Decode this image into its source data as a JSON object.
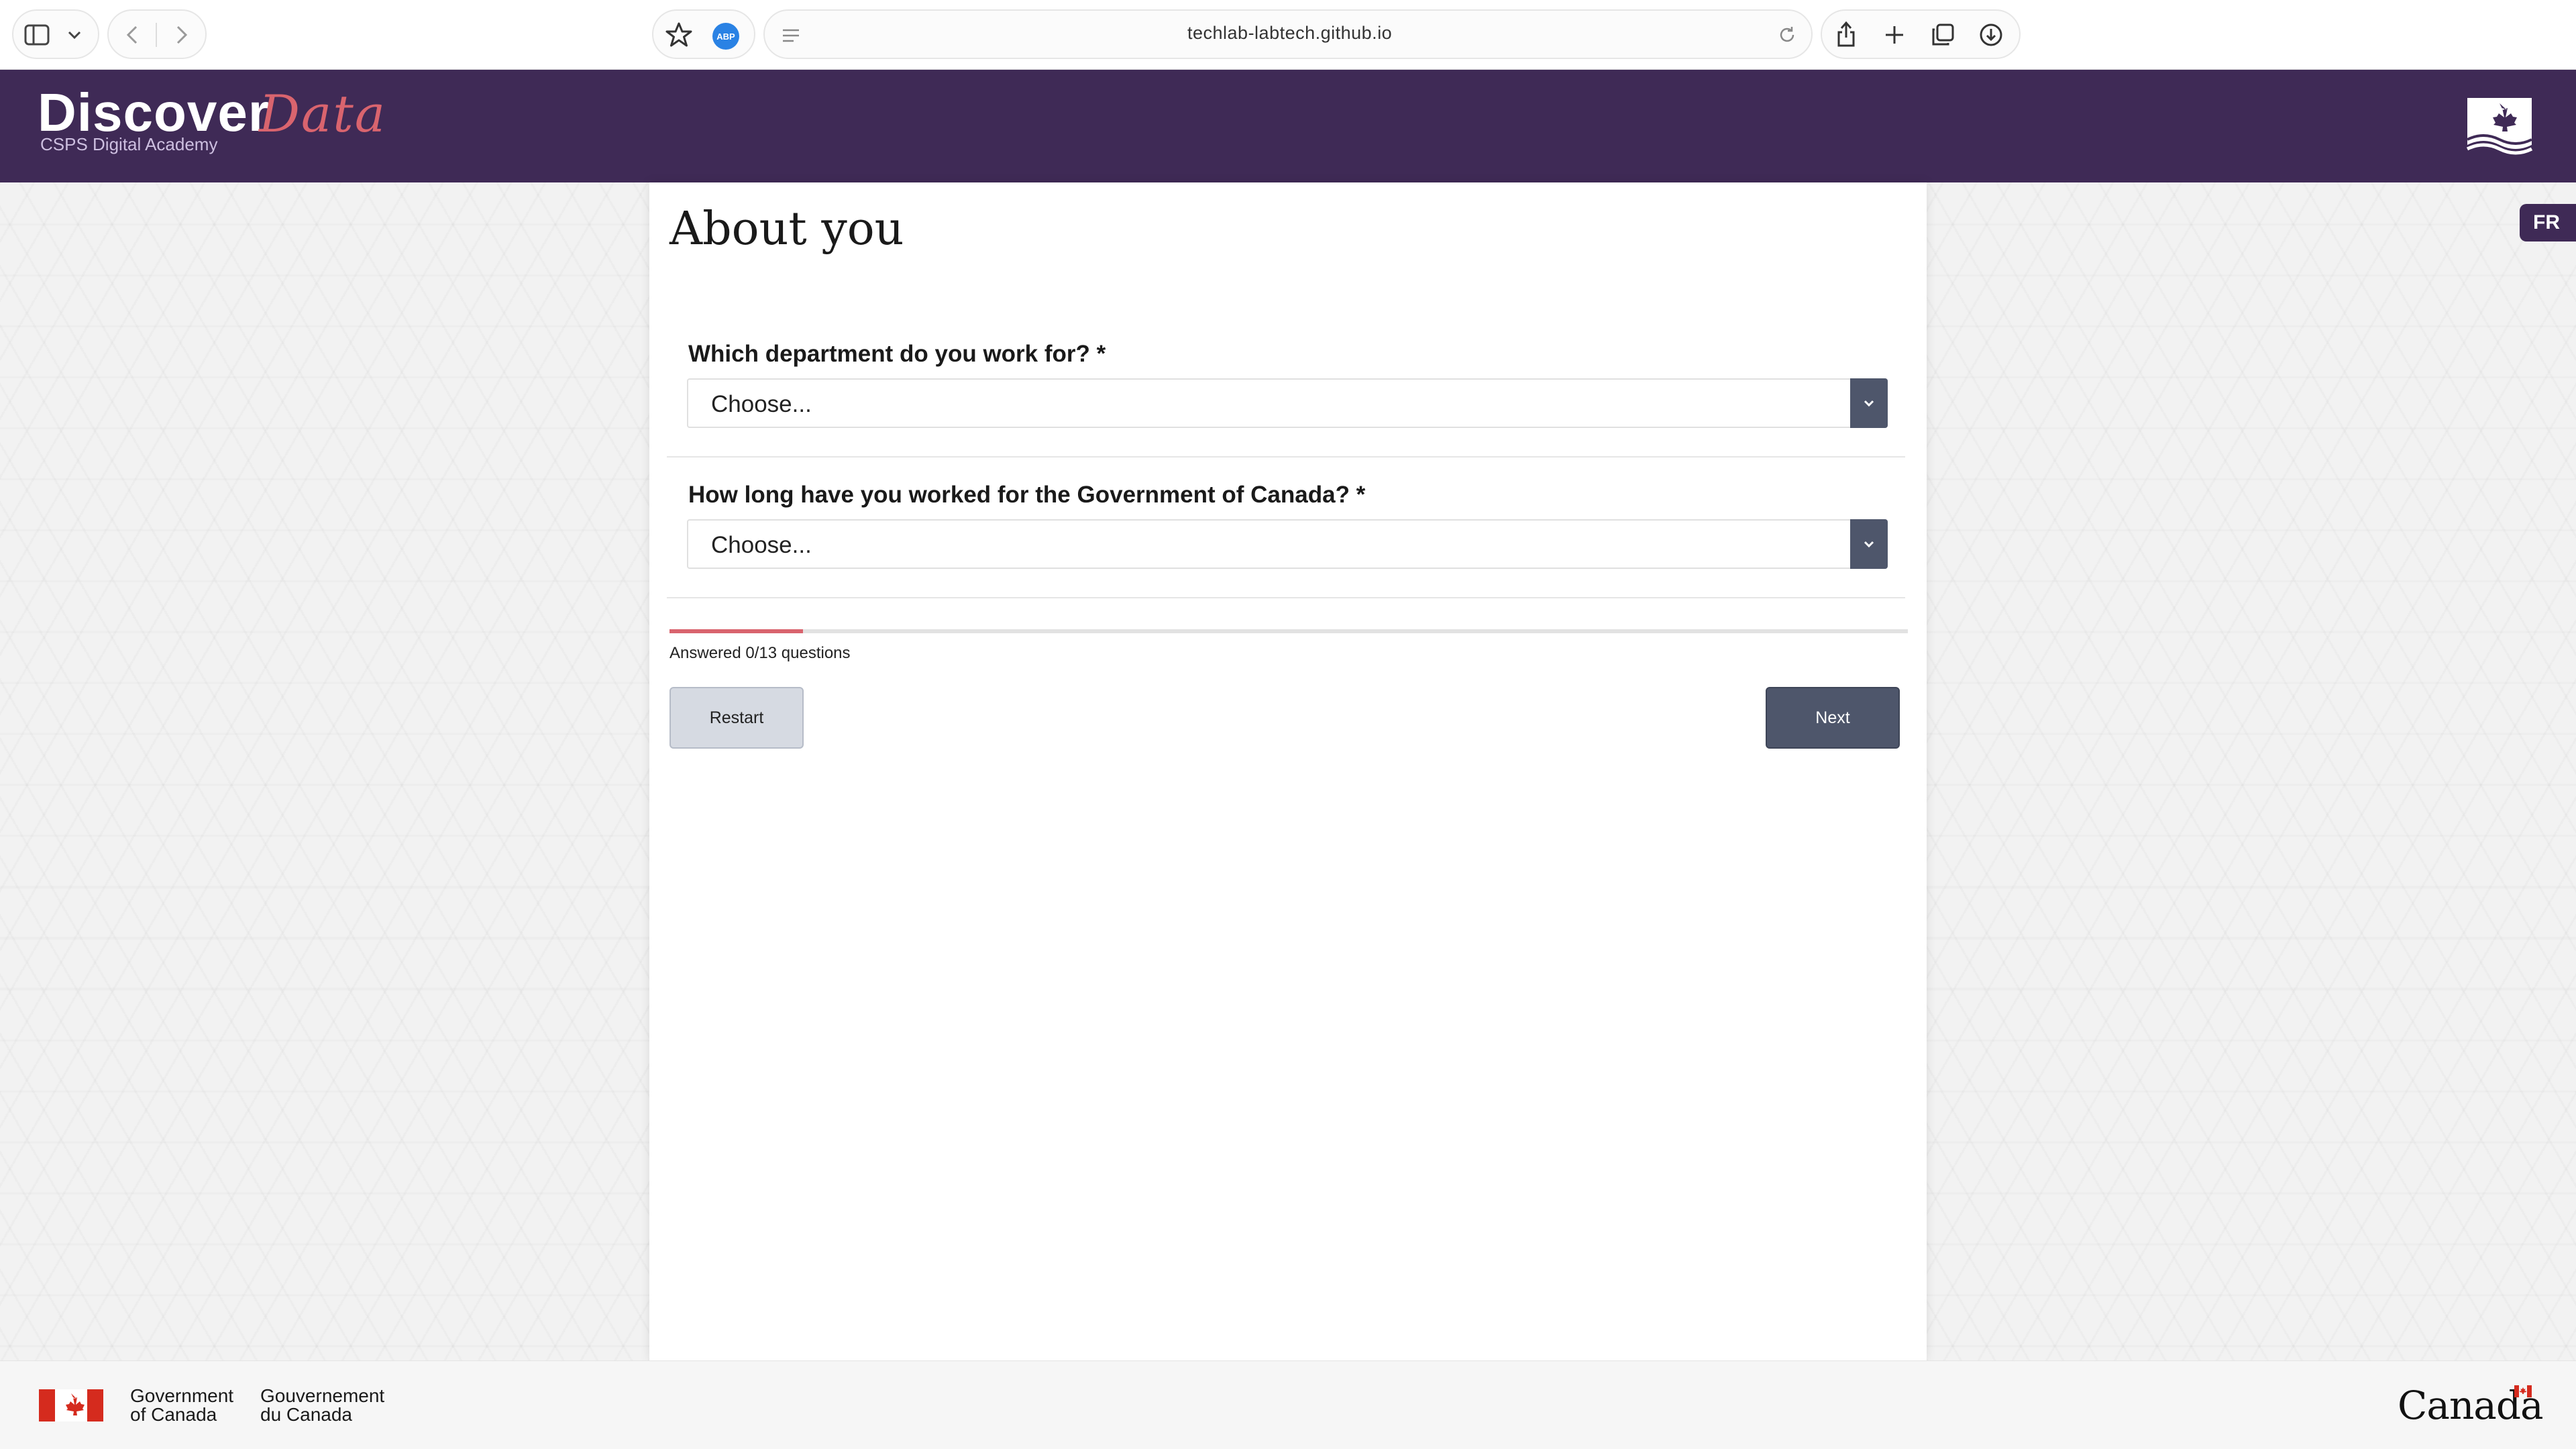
{
  "browser": {
    "url": "techlab-labtech.github.io",
    "extension_label": "ABP",
    "icons": [
      "sidebar-icon",
      "chevron-down-icon",
      "back-icon",
      "forward-icon",
      "star-icon",
      "reader-icon",
      "reload-icon",
      "share-icon",
      "plus-icon",
      "tabs-icon",
      "download-icon"
    ]
  },
  "header": {
    "logo_main": "Discover",
    "logo_accent": "Data",
    "logo_subtitle": "CSPS Digital Academy",
    "emblem_icon": "maple-leaf-emblem-icon"
  },
  "language_toggle": {
    "label": "FR"
  },
  "main": {
    "title": "About you",
    "questions": [
      {
        "label": "Which department do you work for? *",
        "selected": "Choose..."
      },
      {
        "label": "How long have you worked for the Government of Canada? *",
        "selected": "Choose..."
      }
    ],
    "progress": {
      "answered": 0,
      "total": 13,
      "text": "Answered 0/13 questions"
    },
    "buttons": {
      "restart": "Restart",
      "next": "Next"
    }
  },
  "footer": {
    "gov_en_line1": "Government",
    "gov_en_line2": "of Canada",
    "gov_fr_line1": "Gouvernement",
    "gov_fr_line2": "du Canada",
    "wordmark": "Canada"
  },
  "colors": {
    "header_bg": "#3f2a56",
    "accent": "#d9646e",
    "button_dark": "#4e566b",
    "button_light": "#d6dae2",
    "flag_red": "#d52b1e"
  }
}
